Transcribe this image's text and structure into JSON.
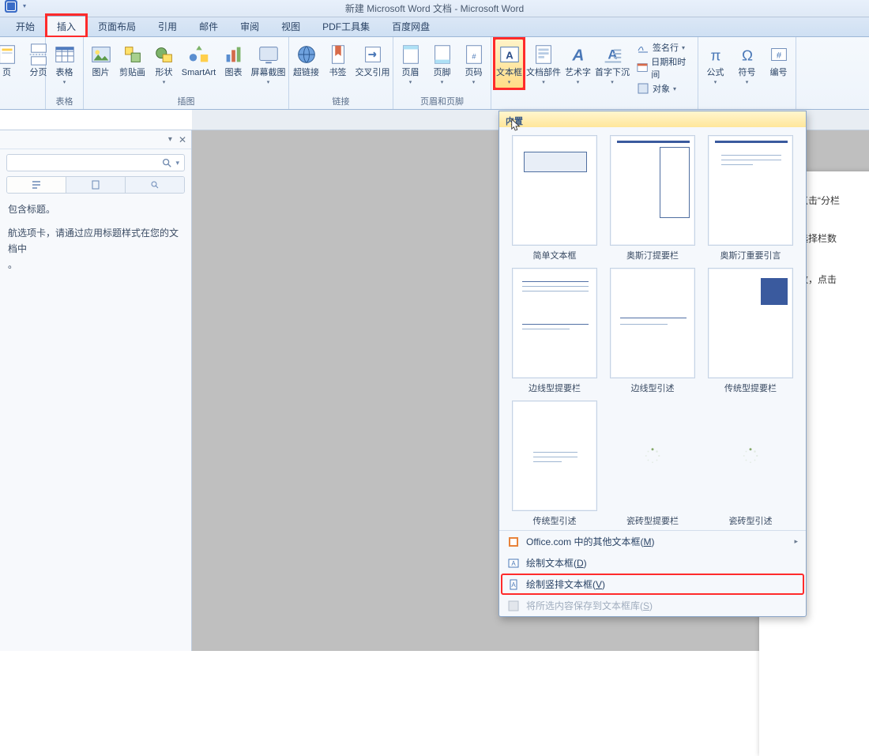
{
  "title": "新建 Microsoft Word 文档 - Microsoft Word",
  "tabs": {
    "start": "开始",
    "insert": "插入",
    "layout": "页面布局",
    "ref": "引用",
    "mail": "邮件",
    "review": "审阅",
    "view": "视图",
    "pdf": "PDF工具集",
    "baidu": "百度网盘"
  },
  "ribbon": {
    "groups": {
      "pages": {
        "label": "",
        "page": "页",
        "section": "分页",
        "table": "表格",
        "tablegrp": "表格"
      },
      "illust": {
        "label": "插图",
        "pic": "图片",
        "clip": "剪贴画",
        "shape": "形状",
        "smart": "SmartArt",
        "chart": "图表",
        "screenshot": "屏幕截图"
      },
      "links": {
        "label": "链接",
        "hyper": "超链接",
        "bookmark": "书签",
        "crossref": "交叉引用"
      },
      "hf": {
        "label": "页眉和页脚",
        "header": "页眉",
        "footer": "页脚",
        "number": "页码"
      },
      "text": {
        "label": "",
        "textbox": "文本框",
        "parts": "文档部件",
        "wordart": "艺术字",
        "dropcap": "首字下沉",
        "sig": "签名行",
        "datetime": "日期和时间",
        "obj": "对象"
      },
      "symbols": {
        "label": "",
        "equation": "公式",
        "symbol": "符号",
        "numbersym": "编号"
      }
    }
  },
  "navpane": {
    "line1": "包含标题。",
    "line2": "航选项卡，请通过应用标题样式在您的文档中",
    "line3": "。"
  },
  "gallery": {
    "header": "内置",
    "items": [
      "简单文本框",
      "奥斯汀提要栏",
      "奥斯汀重要引言",
      "边线型提要栏",
      "边线型引述",
      "传统型提要栏",
      "传统型引述",
      "瓷砖型提要栏",
      "瓷砖型引述"
    ],
    "footer": {
      "office": "Office.com 中的其他文本框(M)",
      "draw": "绘制文本框(D)",
      "drawv": "绘制竖排文本框(V)",
      "save": "将所选内容保存到文本框库(S)"
    }
  },
  "page_text": {
    "l1": "，再点击“分栏",
    "l2": "需要选择栏数",
    "l3": "的栏数，点击"
  }
}
